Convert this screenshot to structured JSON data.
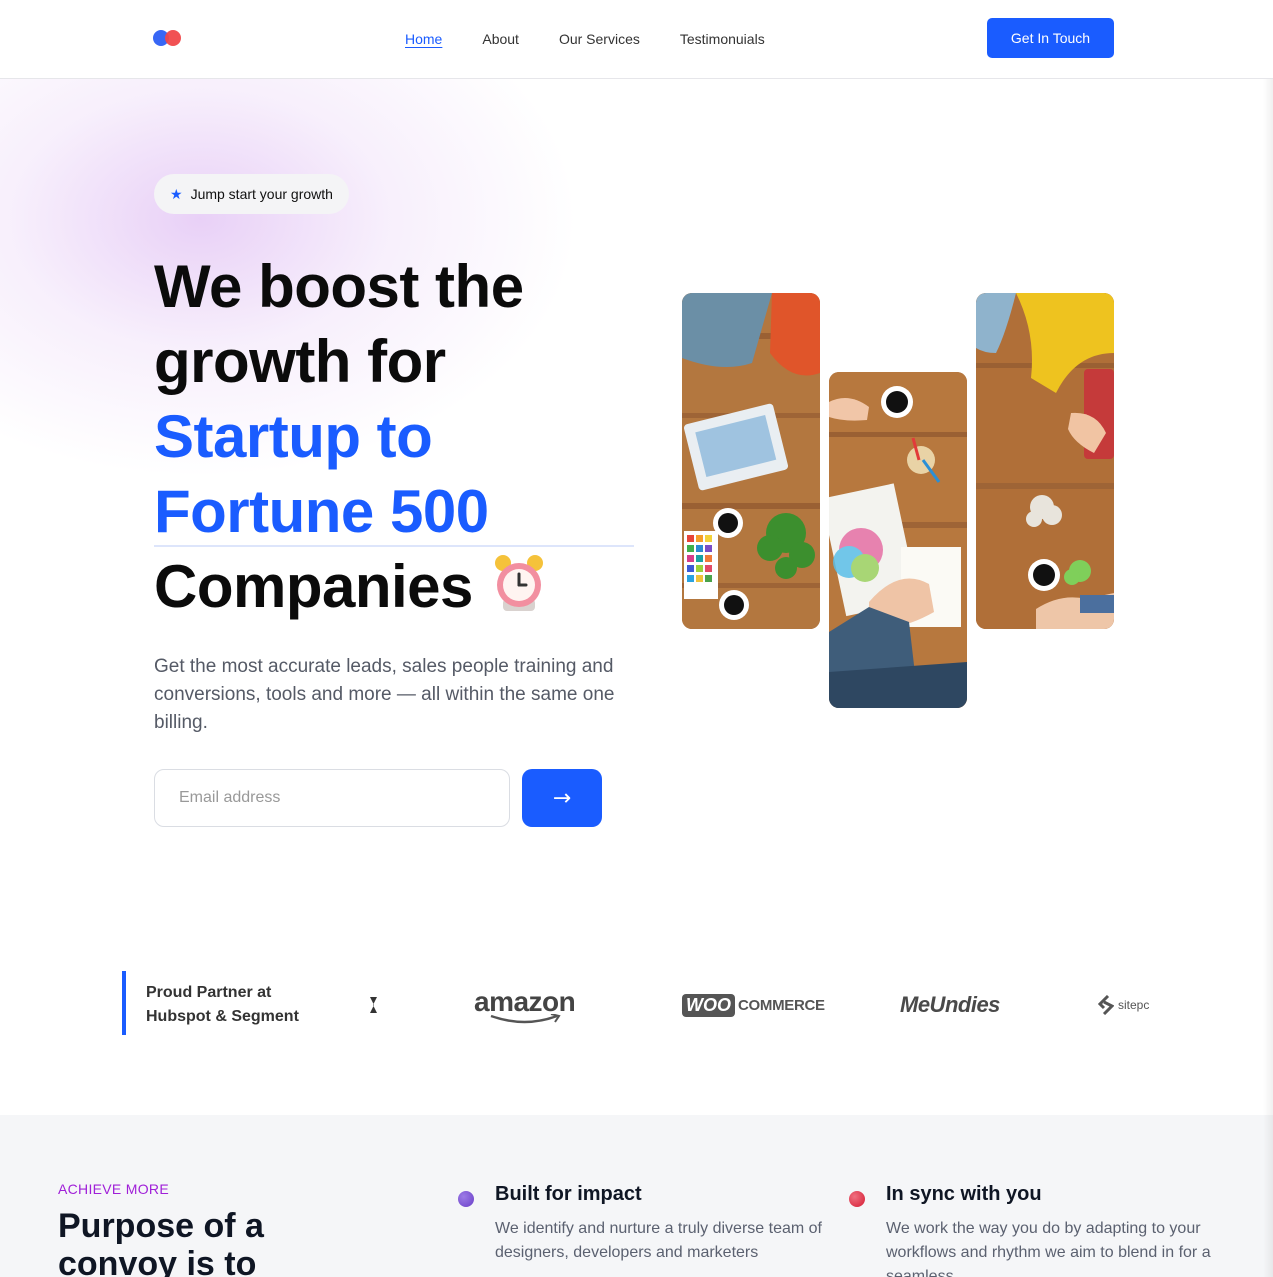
{
  "nav": {
    "links": [
      {
        "label": "Home",
        "active": true
      },
      {
        "label": "About"
      },
      {
        "label": "Our Services"
      },
      {
        "label": "Testimonuials"
      }
    ],
    "cta_label": "Get In Touch"
  },
  "hero": {
    "badge": {
      "icon": "star-icon",
      "text": "Jump start your growth"
    },
    "headline": {
      "line1": "We boost the",
      "line2": "growth for",
      "highlight1": "Startup to",
      "highlight2": "Fortune 500",
      "line5": "Companies",
      "emoji": "alarm-clock-icon"
    },
    "subtext": "Get the most accurate leads, sales people training and conversions, tools and more — all within the same one billing.",
    "email_placeholder": "Email address",
    "submit_icon": "→",
    "accent_color": "#1a5cff"
  },
  "partners": {
    "label_line1": "Proud Partner at",
    "label_line2": "Hubspot & Segment",
    "logos": [
      "amazon",
      "WOO",
      "COMMERCE",
      "MeUndies",
      "sitepc"
    ]
  },
  "features": {
    "eyebrow": "ACHIEVE MORE",
    "title": "Purpose of a convoy is to",
    "items": [
      {
        "title": "Built for impact",
        "text": "We identify and nurture a truly diverse team of designers, developers and marketers",
        "dot_color": "#7b4fd6"
      },
      {
        "title": "In sync with you",
        "text": "We work the way you do by adapting to your workflows and rhythm we aim to blend in for a seamless",
        "dot_color": "#e0283f"
      }
    ]
  }
}
